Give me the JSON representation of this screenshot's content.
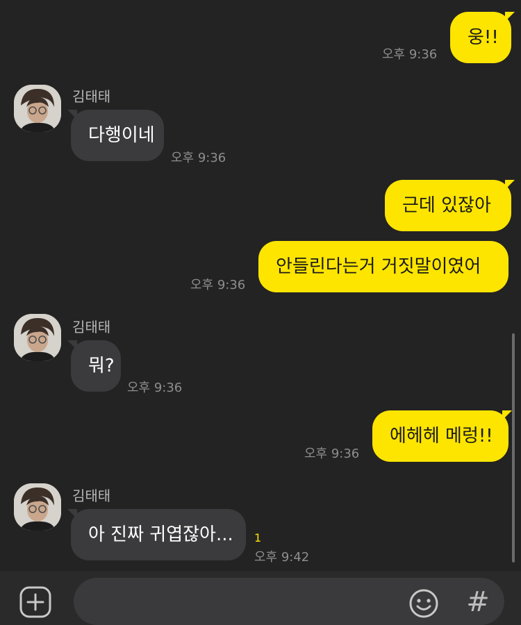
{
  "contact": {
    "name": "김태태"
  },
  "messages": [
    {
      "from": "me",
      "text": "웅!!",
      "time": "오후 9:36"
    },
    {
      "from": "them",
      "sender": "김태태",
      "text": "다행이네",
      "time": "오후 9:36"
    },
    {
      "from": "me",
      "text": "근데 있잖아"
    },
    {
      "from": "me",
      "text": "안들린다는거 거짓말이였어",
      "time": "오후 9:36"
    },
    {
      "from": "them",
      "sender": "김태태",
      "text": "뭐?",
      "time": "오후 9:36"
    },
    {
      "from": "me",
      "text": "에헤헤 메렁!!",
      "time": "오후 9:36"
    },
    {
      "from": "them",
      "sender": "김태태",
      "text": "아 진짜 귀엽잖아...",
      "time": "오후 9:42",
      "unread": "1"
    }
  ],
  "composer": {
    "placeholder": ""
  },
  "icons": {
    "attach": "plus-square-icon",
    "emoji": "smiley-icon",
    "hash": "#"
  },
  "colors": {
    "my_bubble": "#FEE500",
    "their_bubble": "#3b3b3d",
    "background": "#232323"
  }
}
